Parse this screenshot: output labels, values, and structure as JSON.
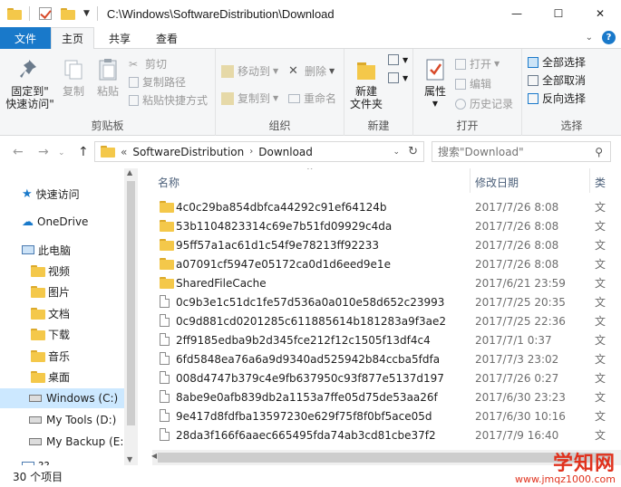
{
  "window": {
    "title": "C:\\Windows\\SoftwareDistribution\\Download",
    "minimize": "—",
    "maximize": "☐",
    "close": "✕"
  },
  "ribbon_tabs": {
    "file": "文件",
    "home": "主页",
    "share": "共享",
    "view": "查看"
  },
  "ribbon": {
    "clipboard": {
      "label": "剪贴板",
      "pin": "固定到\"\n快速访问\"",
      "copy": "复制",
      "paste": "粘贴",
      "cut": "剪切",
      "copy_path": "复制路径",
      "paste_shortcut": "粘贴快捷方式"
    },
    "organize": {
      "label": "组织",
      "move_to": "移动到",
      "copy_to": "复制到",
      "delete": "删除",
      "rename": "重命名"
    },
    "new": {
      "label": "新建",
      "new_folder": "新建\n文件夹"
    },
    "open": {
      "label": "打开",
      "properties": "属性",
      "open": "打开",
      "edit": "编辑",
      "history": "历史记录"
    },
    "select": {
      "label": "选择",
      "select_all": "全部选择",
      "select_none": "全部取消",
      "invert": "反向选择"
    }
  },
  "address": {
    "prefix": "«",
    "crumbs": [
      "SoftwareDistribution",
      "Download"
    ],
    "search_placeholder": "搜索\"Download\""
  },
  "nav": {
    "items": [
      {
        "label": "快速访问",
        "icon": "star-icon"
      },
      {
        "label": "OneDrive",
        "icon": "cloud-icon"
      },
      {
        "label": "此电脑",
        "icon": "computer-icon"
      },
      {
        "label": "视频",
        "icon": "video-folder-icon"
      },
      {
        "label": "图片",
        "icon": "picture-folder-icon"
      },
      {
        "label": "文档",
        "icon": "document-folder-icon"
      },
      {
        "label": "下载",
        "icon": "download-folder-icon"
      },
      {
        "label": "音乐",
        "icon": "music-folder-icon"
      },
      {
        "label": "桌面",
        "icon": "desktop-folder-icon"
      },
      {
        "label": "Windows (C:)",
        "icon": "drive-icon"
      },
      {
        "label": "My Tools (D:)",
        "icon": "drive-icon"
      },
      {
        "label": "My Backup (E:)",
        "icon": "drive-icon"
      },
      {
        "label": "??",
        "icon": "network-icon"
      }
    ]
  },
  "columns": {
    "name": "名称",
    "date": "修改日期",
    "type": "类"
  },
  "files": [
    {
      "name": "4c0c29ba854dbfca44292c91ef64124b",
      "date": "2017/7/26 8:08",
      "type": "文",
      "kind": "folder"
    },
    {
      "name": "53b1104823314c69e7b51fd09929c4da",
      "date": "2017/7/26 8:08",
      "type": "文",
      "kind": "folder"
    },
    {
      "name": "95ff57a1ac61d1c54f9e78213ff92233",
      "date": "2017/7/26 8:08",
      "type": "文",
      "kind": "folder"
    },
    {
      "name": "a07091cf5947e05172ca0d1d6eed9e1e",
      "date": "2017/7/26 8:08",
      "type": "文",
      "kind": "folder"
    },
    {
      "name": "SharedFileCache",
      "date": "2017/6/21 23:59",
      "type": "文",
      "kind": "folder"
    },
    {
      "name": "0c9b3e1c51dc1fe57d536a0a010e58d652c23993",
      "date": "2017/7/25 20:35",
      "type": "文",
      "kind": "file"
    },
    {
      "name": "0c9d881cd0201285c611885614b181283a9f3ae2",
      "date": "2017/7/25 22:36",
      "type": "文",
      "kind": "file"
    },
    {
      "name": "2ff9185edba9b2d345fce212f12c1505f13df4c4",
      "date": "2017/7/1 0:37",
      "type": "文",
      "kind": "file"
    },
    {
      "name": "6fd5848ea76a6a9d9340ad525942b84ccba5fdfa",
      "date": "2017/7/3 23:02",
      "type": "文",
      "kind": "file"
    },
    {
      "name": "008d4747b379c4e9fb637950c93f877e5137d197",
      "date": "2017/7/26 0:27",
      "type": "文",
      "kind": "file"
    },
    {
      "name": "8abe9e0afb839db2a1153a7ffe05d75de53aa26f",
      "date": "2017/6/30 23:23",
      "type": "文",
      "kind": "file"
    },
    {
      "name": "9e417d8fdfba13597230e629f75f8f0bf5ace05d",
      "date": "2017/6/30 10:16",
      "type": "文",
      "kind": "file"
    },
    {
      "name": "28da3f166f6aaec665495fda74ab3cd81cbe37f2",
      "date": "2017/7/9 16:40",
      "type": "文",
      "kind": "file"
    }
  ],
  "status": {
    "count": "30 个项目"
  },
  "watermark": {
    "brand": "学知网",
    "url": "www.jmqz1000.com"
  },
  "colors": {
    "accent": "#1979ca",
    "selection": "#cce8ff",
    "folder": "#f4c84a",
    "watermark": "#e0321e"
  }
}
